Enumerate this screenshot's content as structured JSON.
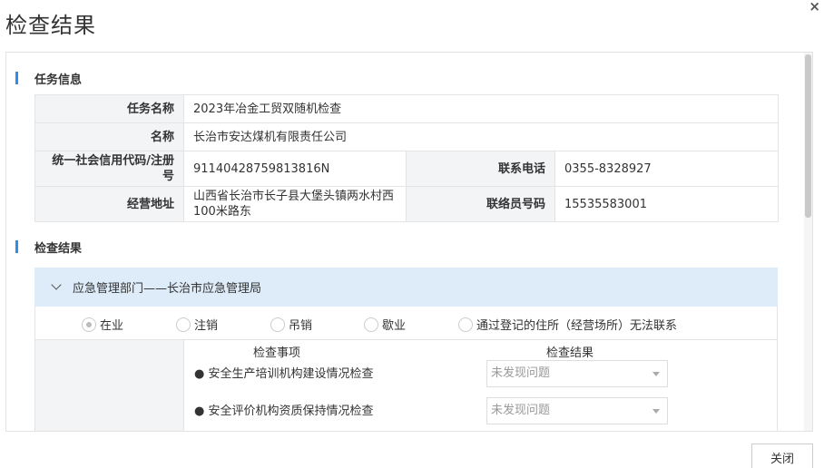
{
  "dialog": {
    "title": "检查结果",
    "close_icon": "×",
    "close_button": "关闭"
  },
  "task_section": {
    "title": "任务信息",
    "rows": {
      "task_name": {
        "label": "任务名称",
        "value": "2023年冶金工贸双随机检查"
      },
      "name": {
        "label": "名称",
        "value": "长治市安达煤机有限责任公司"
      },
      "credit_code": {
        "label": "统一社会信用代码/注册号",
        "value": "91140428759813816N"
      },
      "phone": {
        "label": "联系电话",
        "value": "0355-8328927"
      },
      "address": {
        "label": "经营地址",
        "value": "山西省长治市长子县大堡头镇两水村西100米路东"
      },
      "liaison_number": {
        "label": "联络员号码",
        "value": "15535583001"
      }
    }
  },
  "result_section": {
    "title": "检查结果",
    "department": "应急管理部门——长治市应急管理局",
    "status_options": [
      {
        "label": "在业",
        "checked": true
      },
      {
        "label": "注销",
        "checked": false
      },
      {
        "label": "吊销",
        "checked": false
      },
      {
        "label": "歇业",
        "checked": false
      },
      {
        "label": "通过登记的住所（经营场所）无法联系",
        "checked": false
      }
    ],
    "columns": {
      "item": "检查事项",
      "result": "检查结果"
    },
    "items": [
      {
        "name": "● 安全生产培训机构建设情况检查",
        "result": "未发现问题"
      },
      {
        "name": "● 安全评价机构资质保持情况检查",
        "result": "未发现问题"
      }
    ]
  }
}
